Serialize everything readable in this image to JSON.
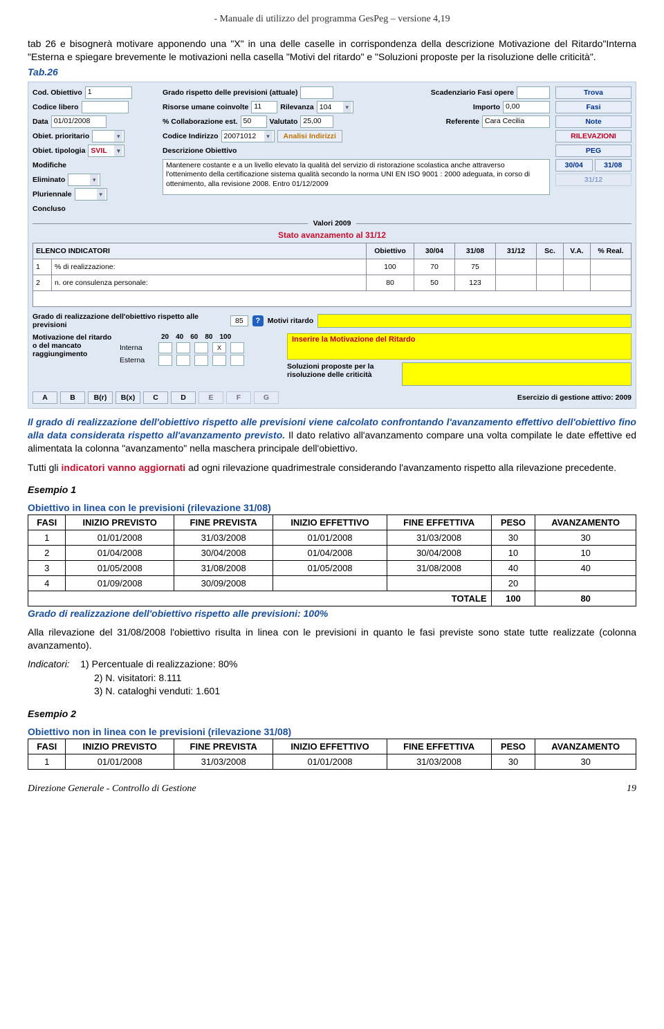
{
  "header": "- Manuale di utilizzo del programma GesPeg – versione 4,19",
  "intro": "tab 26 e bisognerà motivare apponendo una \"X\" in una delle caselle in corrispondenza della descrizione Motivazione del Ritardo\"Interna \"Esterna e spiegare brevemente le motivazioni nella casella \"Motivi del ritardo\" e \"Soluzioni proposte per la risoluzione delle criticità\".",
  "tab_label": "Tab.26",
  "panel": {
    "left": {
      "cod_obiettivo_lbl": "Cod. Obiettivo",
      "cod_obiettivo_val": "1",
      "codice_libero_lbl": "Codice libero",
      "data_lbl": "Data",
      "data_val": "01/01/2008",
      "prior_lbl": "Obiet. prioritario",
      "tipologia_lbl": "Obiet. tipologia",
      "tipologia_val": "SVIL",
      "modifiche_lbl": "Modifiche",
      "eliminato_lbl": "Eliminato",
      "plur_lbl": "Pluriennale",
      "concluso_lbl": "Concluso"
    },
    "mid": {
      "grado_lbl": "Grado rispetto delle previsioni (attuale)",
      "risorse_lbl": "Risorse umane coinvolte",
      "risorse_val": "11",
      "rilevanza_lbl": "Rilevanza",
      "rilevanza_val": "104",
      "importo_lbl": "Importo",
      "importo_val": "0,00",
      "coll_lbl": "% Collaborazione est.",
      "coll_val": "50",
      "valutato_lbl": "Valutato",
      "valutato_val": "25,00",
      "referente_lbl": "Referente",
      "referente_val": "Cara Cecilia",
      "cod_ind_lbl": "Codice Indirizzo",
      "cod_ind_val": "20071012",
      "analisi_btn": "Analisi Indirizzi",
      "scad_lbl": "Scadenziario Fasi opere",
      "desc_lbl": "Descrizione Obiettivo",
      "desc_val": "Mantenere costante e a un livello elevato la qualità del servizio di ristorazione scolastica anche attraverso l'ottenimento della certificazione sistema qualità secondo la norma UNI EN ISO 9001 : 2000 adeguata, in corso di ottenimento, alla revisione 2008. Entro 01/12/2009"
    },
    "right": {
      "trova": "Trova",
      "fasi": "Fasi",
      "note": "Note",
      "rilevaz": "RILEVAZIONI",
      "peg": "PEG",
      "d1": "30/04",
      "d2": "31/08",
      "d3": "31/12"
    },
    "valori": "Valori 2009",
    "stato": "Stato avanzamento al 31/12",
    "table": {
      "h1": "ELENCO INDICATORI",
      "h2": "Obiettivo",
      "h3": "30/04",
      "h4": "31/08",
      "h5": "31/12",
      "h6": "Sc.",
      "h7": "V.A.",
      "h8": "% Real.",
      "rows": [
        {
          "n": "1",
          "d": "% di realizzazione:",
          "ob": "100",
          "c1": "70",
          "c2": "75"
        },
        {
          "n": "2",
          "d": "n. ore consulenza personale:",
          "ob": "80",
          "c1": "50",
          "c2": "123"
        }
      ]
    },
    "grado_prev_lbl": "Grado di realizzazione dell'obiettivo rispetto alle previsioni",
    "grado_prev_val": "85",
    "motivi_lbl": "Motivi ritardo",
    "mot_left_lbl": "Motivazione del ritardo o del mancato raggiungimento",
    "mot_int": "Interna",
    "mot_ext": "Esterna",
    "scale": {
      "c1": "20",
      "c2": "40",
      "c3": "60",
      "c4": "80",
      "c5": "100"
    },
    "sol_lbl": "Soluzioni proposte per la risoluzione delle criticità",
    "yellow_msg": "Inserire la Motivazione del Ritardo",
    "letters": [
      "A",
      "B",
      "B(r)",
      "B(x)",
      "C",
      "D",
      "E",
      "F",
      "G"
    ],
    "esercizio": "Esercizio di gestione attivo:  2009"
  },
  "para1_a": "Il grado di realizzazione dell'obiettivo rispetto alle previsioni viene calcolato confrontando l'avanzamento effettivo dell'obiettivo fino alla data considerata rispetto all'avanzamento previsto.",
  "para1_b": " Il dato relativo all'avanzamento compare una volta compilate le date effettive ed alimentata la colonna \"avanzamento\" nella maschera principale dell'obiettivo.",
  "para2_a": "Tutti gli ",
  "para2_b": "indicatori vanno aggiornati",
  "para2_c": " ad ogni rilevazione quadrimestrale considerando l'avanzamento rispetto alla rilevazione precedente.",
  "esempio1": "Esempio 1",
  "table1_title": "Obiettivo in linea con le previsioni (rilevazione 31/08)",
  "fasi_headers": {
    "fasi": "FASI",
    "ip": "INIZIO PREVISTO",
    "fp": "FINE PREVISTA",
    "ie": "INIZIO EFFETTIVO",
    "fe": "FINE EFFETTIVA",
    "peso": "PESO",
    "av": "AVANZAMENTO"
  },
  "table1_rows": [
    {
      "f": "1",
      "ip": "01/01/2008",
      "fp": "31/03/2008",
      "ie": "01/01/2008",
      "fe": "31/03/2008",
      "p": "30",
      "a": "30"
    },
    {
      "f": "2",
      "ip": "01/04/2008",
      "fp": "30/04/2008",
      "ie": "01/04/2008",
      "fe": "30/04/2008",
      "p": "10",
      "a": "10"
    },
    {
      "f": "3",
      "ip": "01/05/2008",
      "fp": "31/08/2008",
      "ie": "01/05/2008",
      "fe": "31/08/2008",
      "p": "40",
      "a": "40"
    },
    {
      "f": "4",
      "ip": "01/09/2008",
      "fp": "30/09/2008",
      "ie": "",
      "fe": "",
      "p": "20",
      "a": ""
    }
  ],
  "totale_lbl": "TOTALE",
  "totale_p": "100",
  "totale_a": "80",
  "grado_text": "Grado di realizzazione dell'obiettivo rispetto alle previsioni: 100%",
  "alla_rilev": "Alla rilevazione del 31/08/2008 l'obiettivo risulta in linea con le previsioni in quanto le fasi previste sono state tutte realizzate (colonna avanzamento).",
  "indic_lbl": "Indicatori:",
  "indic1": "1) Percentuale di realizzazione: 80%",
  "indic2": "2) N. visitatori: 8.111",
  "indic3": "3) N. cataloghi venduti: 1.601",
  "esempio2": "Esempio 2",
  "table2_title": "Obiettivo non in linea con le previsioni (rilevazione 31/08)",
  "table2_rows": [
    {
      "f": "1",
      "ip": "01/01/2008",
      "fp": "31/03/2008",
      "ie": "01/01/2008",
      "fe": "31/03/2008",
      "p": "30",
      "a": "30"
    }
  ],
  "footer_left": "Direzione Generale - Controllo di Gestione",
  "footer_right": "19"
}
